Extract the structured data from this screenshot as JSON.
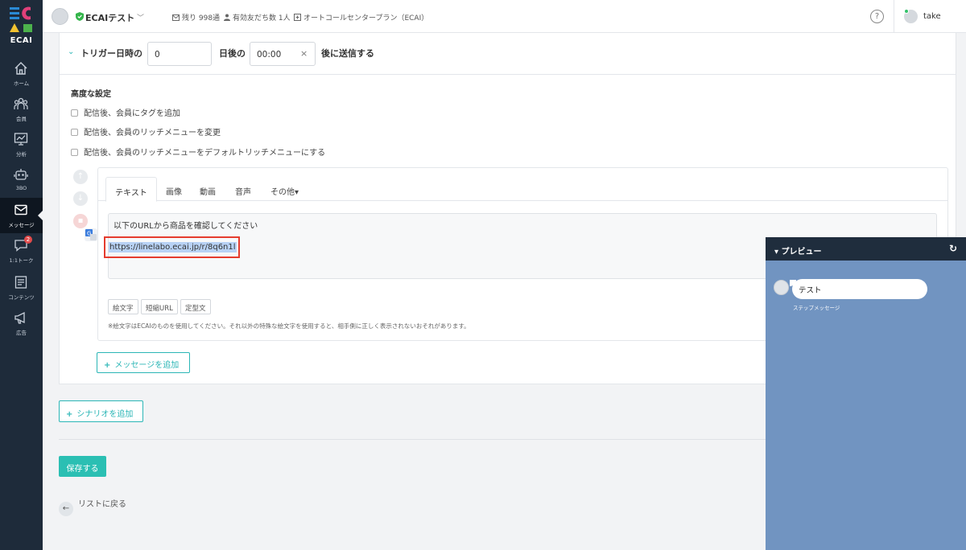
{
  "brand": {
    "logo_text": "ECAI",
    "colors": {
      "teal": "#2bb6b6",
      "sidebar": "#1e2b3a",
      "logo_blue": "#2a8ad4",
      "logo_pink": "#e0407a",
      "logo_yellow": "#f2c230",
      "logo_green": "#4cb24c"
    }
  },
  "sidebar": {
    "items": [
      {
        "label": "ホーム",
        "icon": "home-icon"
      },
      {
        "label": "会員",
        "icon": "members-icon"
      },
      {
        "label": "分析",
        "icon": "chart-icon"
      },
      {
        "label": "3BO",
        "icon": "robot-icon"
      },
      {
        "label": "メッセージ",
        "icon": "envelope-icon",
        "active": true
      },
      {
        "label": "1:1トーク",
        "icon": "chat-icon",
        "badge": "2"
      },
      {
        "label": "コンテンツ",
        "icon": "content-icon"
      },
      {
        "label": "広告",
        "icon": "megaphone-icon"
      }
    ]
  },
  "topbar": {
    "account_name": "ECAIテスト",
    "remaining": "残り 998通",
    "friends": "有効友だち数 1人",
    "plan": "オートコールセンタープラン（ECAI）",
    "help": "?",
    "user": "take"
  },
  "trigger": {
    "label": "トリガー日時の",
    "days_value": "0",
    "days_label": "日後の",
    "time_value": "00:00",
    "clear": "×",
    "send_label": "後に送信する"
  },
  "advanced": {
    "title": "高度な設定",
    "options": [
      "配信後、会員にタグを追加",
      "配信後、会員のリッチメニューを変更",
      "配信後、会員のリッチメニューをデフォルトリッチメニューにする"
    ]
  },
  "editor": {
    "tabs": [
      "テキスト",
      "画像",
      "動画",
      "音声",
      "その他▾"
    ],
    "text_line1": "以下のURLから商品を確認してください",
    "url": "https://linelabo.ecai.jp/r/8q6n1l",
    "buttons": [
      "絵文字",
      "短縮URL",
      "定型文"
    ],
    "note": "※絵文字はECAIのものを使用してください。それ以外の特殊な絵文字を使用すると、相手側に正しく表示されないおそれがあります。"
  },
  "actions": {
    "add_message": "メッセージを追加",
    "add_scenario": "シナリオを追加",
    "save": "保存する",
    "back": "リストに戻る",
    "plus": "+"
  },
  "preview": {
    "title": "プレビュー",
    "refresh": "↻",
    "bubble_text": "テスト",
    "caption": "ステップメッセージ"
  }
}
